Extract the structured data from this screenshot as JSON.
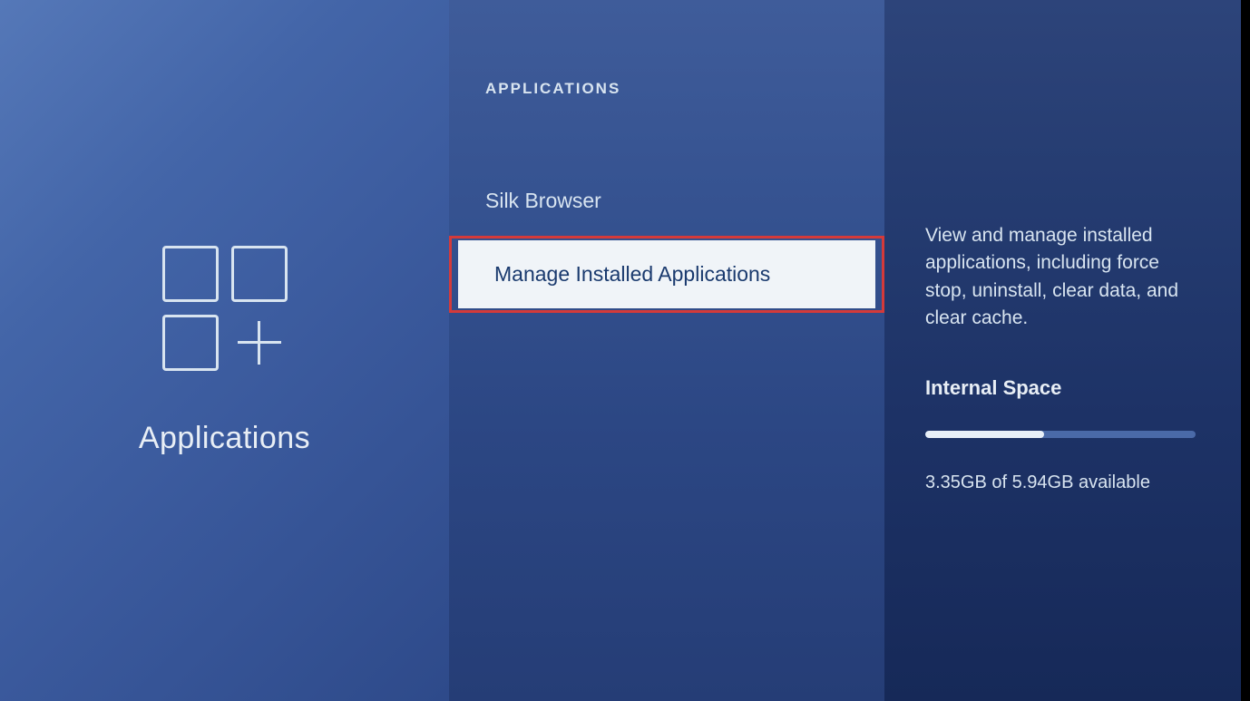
{
  "leftPanel": {
    "title": "Applications"
  },
  "middlePanel": {
    "header": "APPLICATIONS",
    "items": [
      {
        "label": "Silk Browser",
        "selected": false
      },
      {
        "label": "Manage Installed Applications",
        "selected": true
      }
    ]
  },
  "rightPanel": {
    "description": "View and manage installed applications, including force stop, uninstall, clear data, and clear cache.",
    "storageLabel": "Internal Space",
    "storageText": "3.35GB of 5.94GB available",
    "storagePercent": 44
  }
}
